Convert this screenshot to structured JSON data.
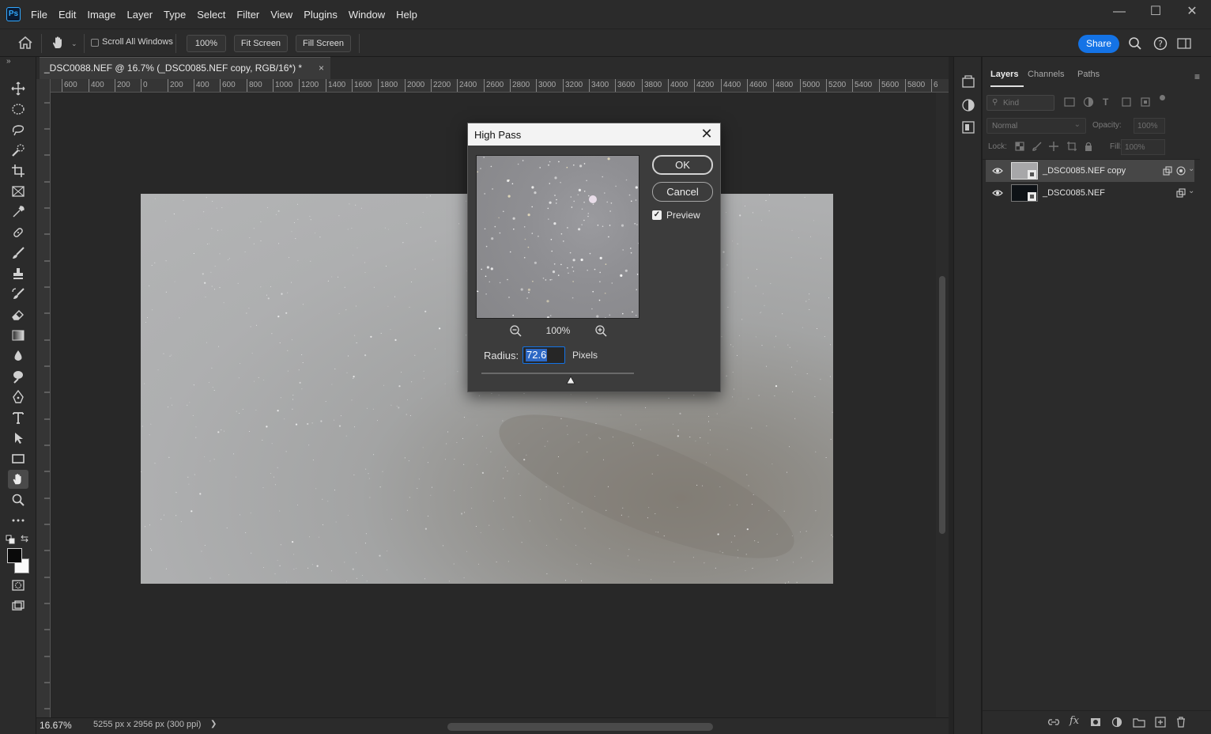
{
  "app": {
    "logo": "Ps",
    "menu": [
      "File",
      "Edit",
      "Image",
      "Layer",
      "Type",
      "Select",
      "Filter",
      "View",
      "Plugins",
      "Window",
      "Help"
    ],
    "window_controls": {
      "minimize": "—",
      "maximize": "☐",
      "close": "✕"
    }
  },
  "options_bar": {
    "scroll_all_windows": "Scroll All Windows",
    "zoom_100": "100%",
    "fit_screen": "Fit Screen",
    "fill_screen": "Fill Screen",
    "share": "Share"
  },
  "document": {
    "tab_title": "_DSC0088.NEF @ 16.7% (_DSC0085.NEF copy, RGB/16*) *",
    "tab_close": "×",
    "ruler_labels": [
      "600",
      "400",
      "200",
      "0",
      "200",
      "400",
      "600",
      "800",
      "1000",
      "1200",
      "1400",
      "1600",
      "1800",
      "2000",
      "2200",
      "2400",
      "2600",
      "2800",
      "3000",
      "3200",
      "3400",
      "3600",
      "3800",
      "4000",
      "4200",
      "4400",
      "4600",
      "4800",
      "5000",
      "5200",
      "5400",
      "5600",
      "5800",
      "6"
    ],
    "zoom_status": "16.67%",
    "size_status": "5255 px x 2956 px (300 ppi)",
    "status_arrow": "❯"
  },
  "panels": {
    "tabs": [
      "Layers",
      "Channels",
      "Paths"
    ],
    "active_tab": "Layers",
    "filter_kind": "Kind",
    "blend_mode": "Normal",
    "opacity_label": "Opacity:",
    "opacity_value": "100%",
    "lock_label": "Lock:",
    "fill_label": "Fill:",
    "fill_value": "100%",
    "layers": [
      {
        "name": "_DSC0085.NEF copy",
        "visible": true,
        "selected": true
      },
      {
        "name": "_DSC0085.NEF",
        "visible": true,
        "selected": false
      }
    ]
  },
  "dialog": {
    "title": "High Pass",
    "close": "✕",
    "ok": "OK",
    "cancel": "Cancel",
    "preview_label": "Preview",
    "preview_checked": true,
    "zoom_percent": "100%",
    "radius_label": "Radius:",
    "radius_value": "72.6",
    "radius_unit": "Pixels"
  }
}
